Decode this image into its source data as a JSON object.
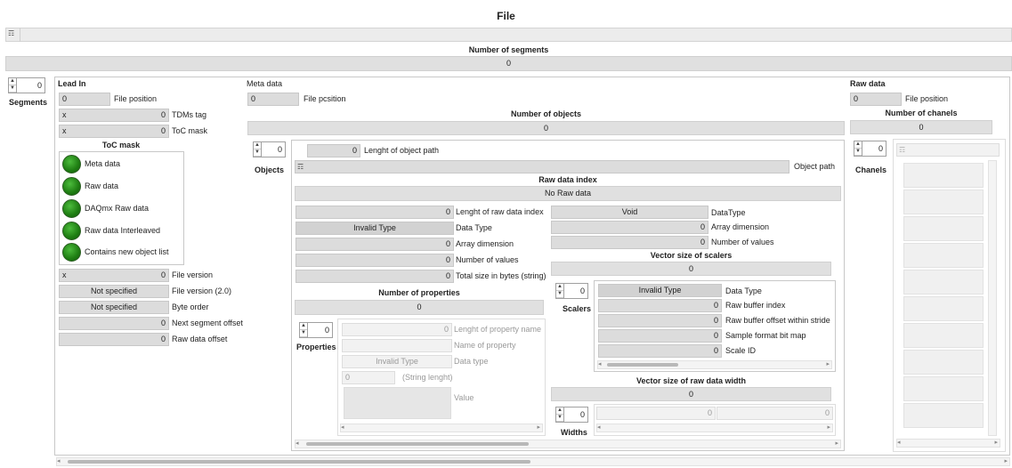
{
  "file": {
    "title": "File"
  },
  "segments_header": {
    "title": "Number of segments",
    "value": "0"
  },
  "segments": {
    "spinner_value": "0",
    "label": "Segments"
  },
  "lead_in": {
    "title": "Lead In",
    "file_position_value": "0",
    "file_position_label": "File position",
    "tdms_tag_prefix": "x",
    "tdms_tag_value": "0",
    "tdms_tag_label": "TDMs tag",
    "toc_mask_prefix": "x",
    "toc_mask_value": "0",
    "toc_mask_label": "ToC mask",
    "toc_mask_title": "ToC mask",
    "toc_items": [
      "Meta data",
      "Raw data",
      "DAQmx Raw data",
      "Raw data Interleaved",
      "Contains new object list"
    ],
    "file_version_prefix": "x",
    "file_version_value": "0",
    "file_version_label": "File version",
    "file_version2_value": "Not specified",
    "file_version2_label": "File version (2.0)",
    "byte_order_value": "Not specified",
    "byte_order_label": "Byte order",
    "next_segment_value": "0",
    "next_segment_label": "Next segment offset",
    "raw_data_offset_value": "0",
    "raw_data_offset_label": "Raw data offset"
  },
  "meta_data": {
    "title": "Meta data",
    "file_position_value": "0",
    "file_position_label": "File pcsition",
    "num_objects_title": "Number of objects",
    "num_objects_value": "0",
    "objects_spinner": "0",
    "objects_label": "Objects",
    "path_length_value": "0",
    "path_length_label": "Lenght of object path",
    "object_path_label": "Object path",
    "raw_index_title": "Raw data index",
    "raw_index_value": "No Raw data",
    "raw_index_len_value": "0",
    "raw_index_len_label": "Lenght of raw data index",
    "data_type_value": "Invalid Type",
    "data_type_label": "Data Type",
    "array_dim_value": "0",
    "array_dim_label": "Array dimension",
    "num_values_value": "0",
    "num_values_label": "Number of values",
    "total_size_value": "0",
    "total_size_label": "Total size in bytes (string)",
    "num_props_title": "Number of properties",
    "num_props_value": "0",
    "props_spinner": "0",
    "props_label": "Properties",
    "prop_name_len_value": "0",
    "prop_name_len_label": "Lenght of property name",
    "prop_name_label": "Name of property",
    "prop_type_value": "Invalid Type",
    "prop_type_label": "Data type",
    "prop_strlen_value": "0",
    "prop_strlen_label": "(String lenght)",
    "prop_value_label": "Value",
    "dt2_value": "Void",
    "dt2_label": "DataType",
    "arr2_value": "0",
    "arr2_label": "Array dimension",
    "nv2_value": "0",
    "nv2_label": "Number of values",
    "scalers_title": "Vector size of scalers",
    "scalers_value": "0",
    "scalers_spinner": "0",
    "scalers_label": "Scalers",
    "sc_type_value": "Invalid Type",
    "sc_type_label": "Data Type",
    "sc_rbi_value": "0",
    "sc_rbi_label": "Raw buffer index",
    "sc_rbo_value": "0",
    "sc_rbo_label": "Raw buffer offset within stride",
    "sc_sfb_value": "0",
    "sc_sfb_label": "Sample format bit map",
    "sc_sid_value": "0",
    "sc_sid_label": "Scale ID",
    "widths_title": "Vector size of raw data width",
    "widths_value": "0",
    "widths_spinner": "0",
    "widths_label": "Widths",
    "w_val1": "0",
    "w_val2": "0"
  },
  "raw_data": {
    "title": "Raw data",
    "file_position_value": "0",
    "file_position_label": "File position",
    "num_channels_title": "Number of chanels",
    "num_channels_value": "0",
    "channels_spinner": "0",
    "channels_label": "Chanels"
  },
  "icons": {
    "tree": "tree-structure-icon"
  }
}
